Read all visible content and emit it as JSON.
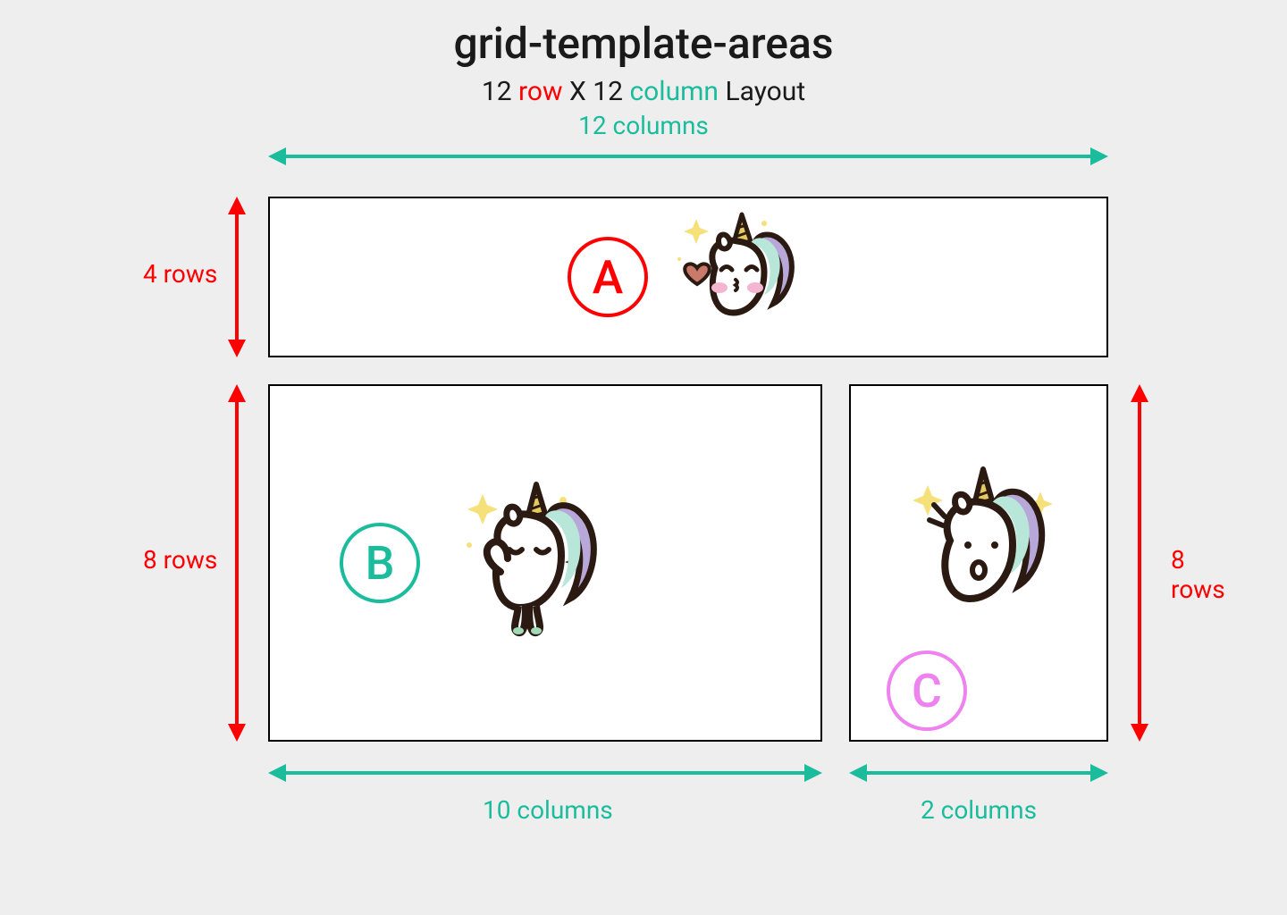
{
  "title": "grid-template-areas",
  "subtitle": {
    "num_rows": "12",
    "row_word": "row",
    "x": "X",
    "num_cols": "12",
    "col_word": "column",
    "layout": "Layout"
  },
  "areas": {
    "a": {
      "letter": "A",
      "rows_label": "4 rows",
      "cols_label": "12 columns"
    },
    "b": {
      "letter": "B",
      "rows_label": "8 rows",
      "cols_label": "10 columns"
    },
    "c": {
      "letter": "C",
      "rows_label": "8 rows",
      "cols_label": "2 columns"
    }
  },
  "colors": {
    "red": "#ff0000",
    "teal": "#1abc9c",
    "pink": "#ee82ee"
  },
  "chart_data": {
    "type": "table",
    "title": "grid-template-areas 12x12 layout",
    "grid_rows": 12,
    "grid_cols": 12,
    "areas": [
      {
        "name": "A",
        "rows": 4,
        "cols": 12
      },
      {
        "name": "B",
        "rows": 8,
        "cols": 10
      },
      {
        "name": "C",
        "rows": 8,
        "cols": 2
      }
    ]
  }
}
